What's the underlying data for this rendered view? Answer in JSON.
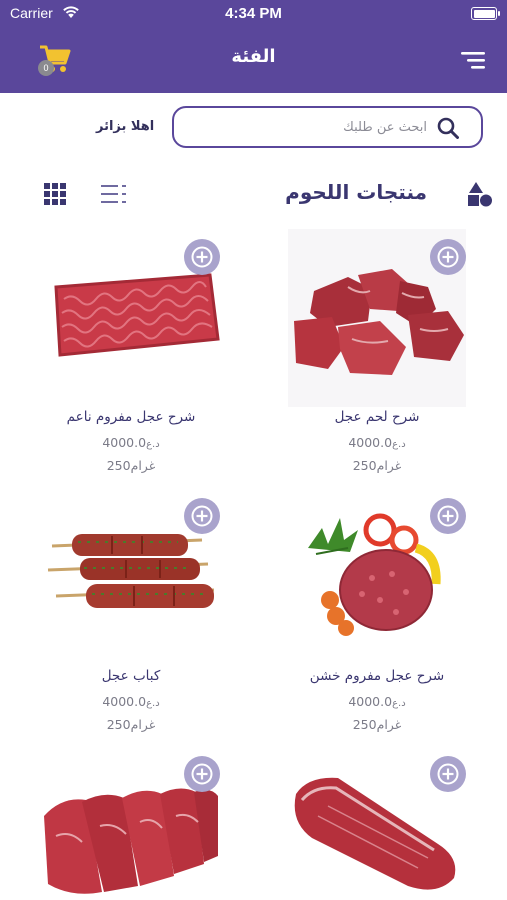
{
  "status_bar": {
    "carrier": "Carrier",
    "time": "4:34 PM"
  },
  "header": {
    "title": "الفئة",
    "cart_count": "0"
  },
  "search": {
    "placeholder": "ابحث عن طلبك",
    "value": "",
    "greeting": "اهلا بزائر"
  },
  "section": {
    "title": "منتجات اللحوم"
  },
  "colors": {
    "brand": "#5a479b",
    "add_button": "#a9a3cc",
    "text_dark": "#3a3670",
    "text_muted": "#7b7b88"
  },
  "products": [
    {
      "name": "شرح لحم عجل",
      "price": "4000.0",
      "currency": "د.ع",
      "weight": "250",
      "weight_unit": "غرام",
      "image": "beef-cubes"
    },
    {
      "name": "شرح عجل مفروم ناعم",
      "price": "4000.0",
      "currency": "د.ع",
      "weight": "250",
      "weight_unit": "غرام",
      "image": "fine-minced-beef"
    },
    {
      "name": "شرح عجل مفروم خشن",
      "price": "4000.0",
      "currency": "د.ع",
      "weight": "250",
      "weight_unit": "غرام",
      "image": "coarse-minced-beef"
    },
    {
      "name": "كباب عجل",
      "price": "4000.0",
      "currency": "د.ع",
      "weight": "250",
      "weight_unit": "غرام",
      "image": "beef-kebab"
    },
    {
      "image": "beef-fillet"
    },
    {
      "image": "beef-steaks"
    }
  ]
}
